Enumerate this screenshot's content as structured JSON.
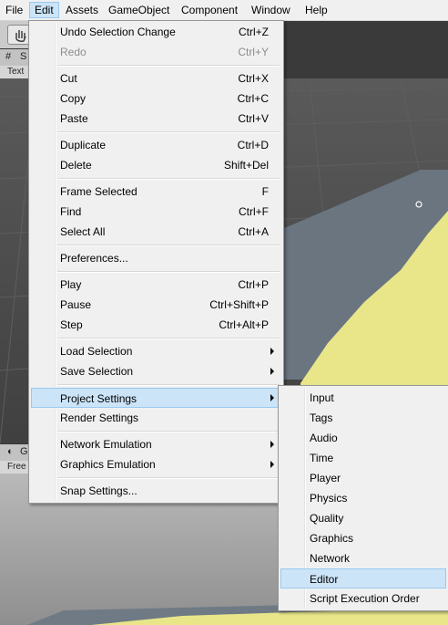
{
  "menubar": {
    "items": [
      {
        "label": "File"
      },
      {
        "label": "Edit"
      },
      {
        "label": "Assets"
      },
      {
        "label": "GameObject"
      },
      {
        "label": "Component"
      },
      {
        "label": "Window"
      },
      {
        "label": "Help"
      }
    ]
  },
  "background": {
    "scene_tab_label": "S",
    "scene_subtab_label": "Text",
    "game_tab_label": "G",
    "game_subtab_label": "Free",
    "colors": {
      "scene": "#4a4a4a",
      "plane": "#6a7580",
      "terrain": "#e8e689",
      "game": "#a8a8a8"
    }
  },
  "edit_menu": {
    "items": [
      {
        "label": "Undo Selection Change",
        "shortcut": "Ctrl+Z"
      },
      {
        "label": "Redo",
        "shortcut": "Ctrl+Y",
        "disabled": true
      },
      {
        "label": "Cut",
        "shortcut": "Ctrl+X"
      },
      {
        "label": "Copy",
        "shortcut": "Ctrl+C"
      },
      {
        "label": "Paste",
        "shortcut": "Ctrl+V"
      },
      {
        "label": "Duplicate",
        "shortcut": "Ctrl+D"
      },
      {
        "label": "Delete",
        "shortcut": "Shift+Del"
      },
      {
        "label": "Frame Selected",
        "shortcut": "F"
      },
      {
        "label": "Find",
        "shortcut": "Ctrl+F"
      },
      {
        "label": "Select All",
        "shortcut": "Ctrl+A"
      },
      {
        "label": "Preferences..."
      },
      {
        "label": "Play",
        "shortcut": "Ctrl+P"
      },
      {
        "label": "Pause",
        "shortcut": "Ctrl+Shift+P"
      },
      {
        "label": "Step",
        "shortcut": "Ctrl+Alt+P"
      },
      {
        "label": "Load Selection",
        "submenu": true
      },
      {
        "label": "Save Selection",
        "submenu": true
      },
      {
        "label": "Project Settings",
        "submenu": true,
        "highlighted": true
      },
      {
        "label": "Render Settings"
      },
      {
        "label": "Network Emulation",
        "submenu": true
      },
      {
        "label": "Graphics Emulation",
        "submenu": true
      },
      {
        "label": "Snap Settings..."
      }
    ]
  },
  "project_settings_menu": {
    "items": [
      {
        "label": "Input"
      },
      {
        "label": "Tags"
      },
      {
        "label": "Audio"
      },
      {
        "label": "Time"
      },
      {
        "label": "Player"
      },
      {
        "label": "Physics"
      },
      {
        "label": "Quality"
      },
      {
        "label": "Graphics"
      },
      {
        "label": "Network"
      },
      {
        "label": "Editor",
        "highlighted": true
      },
      {
        "label": "Script Execution Order"
      }
    ]
  }
}
